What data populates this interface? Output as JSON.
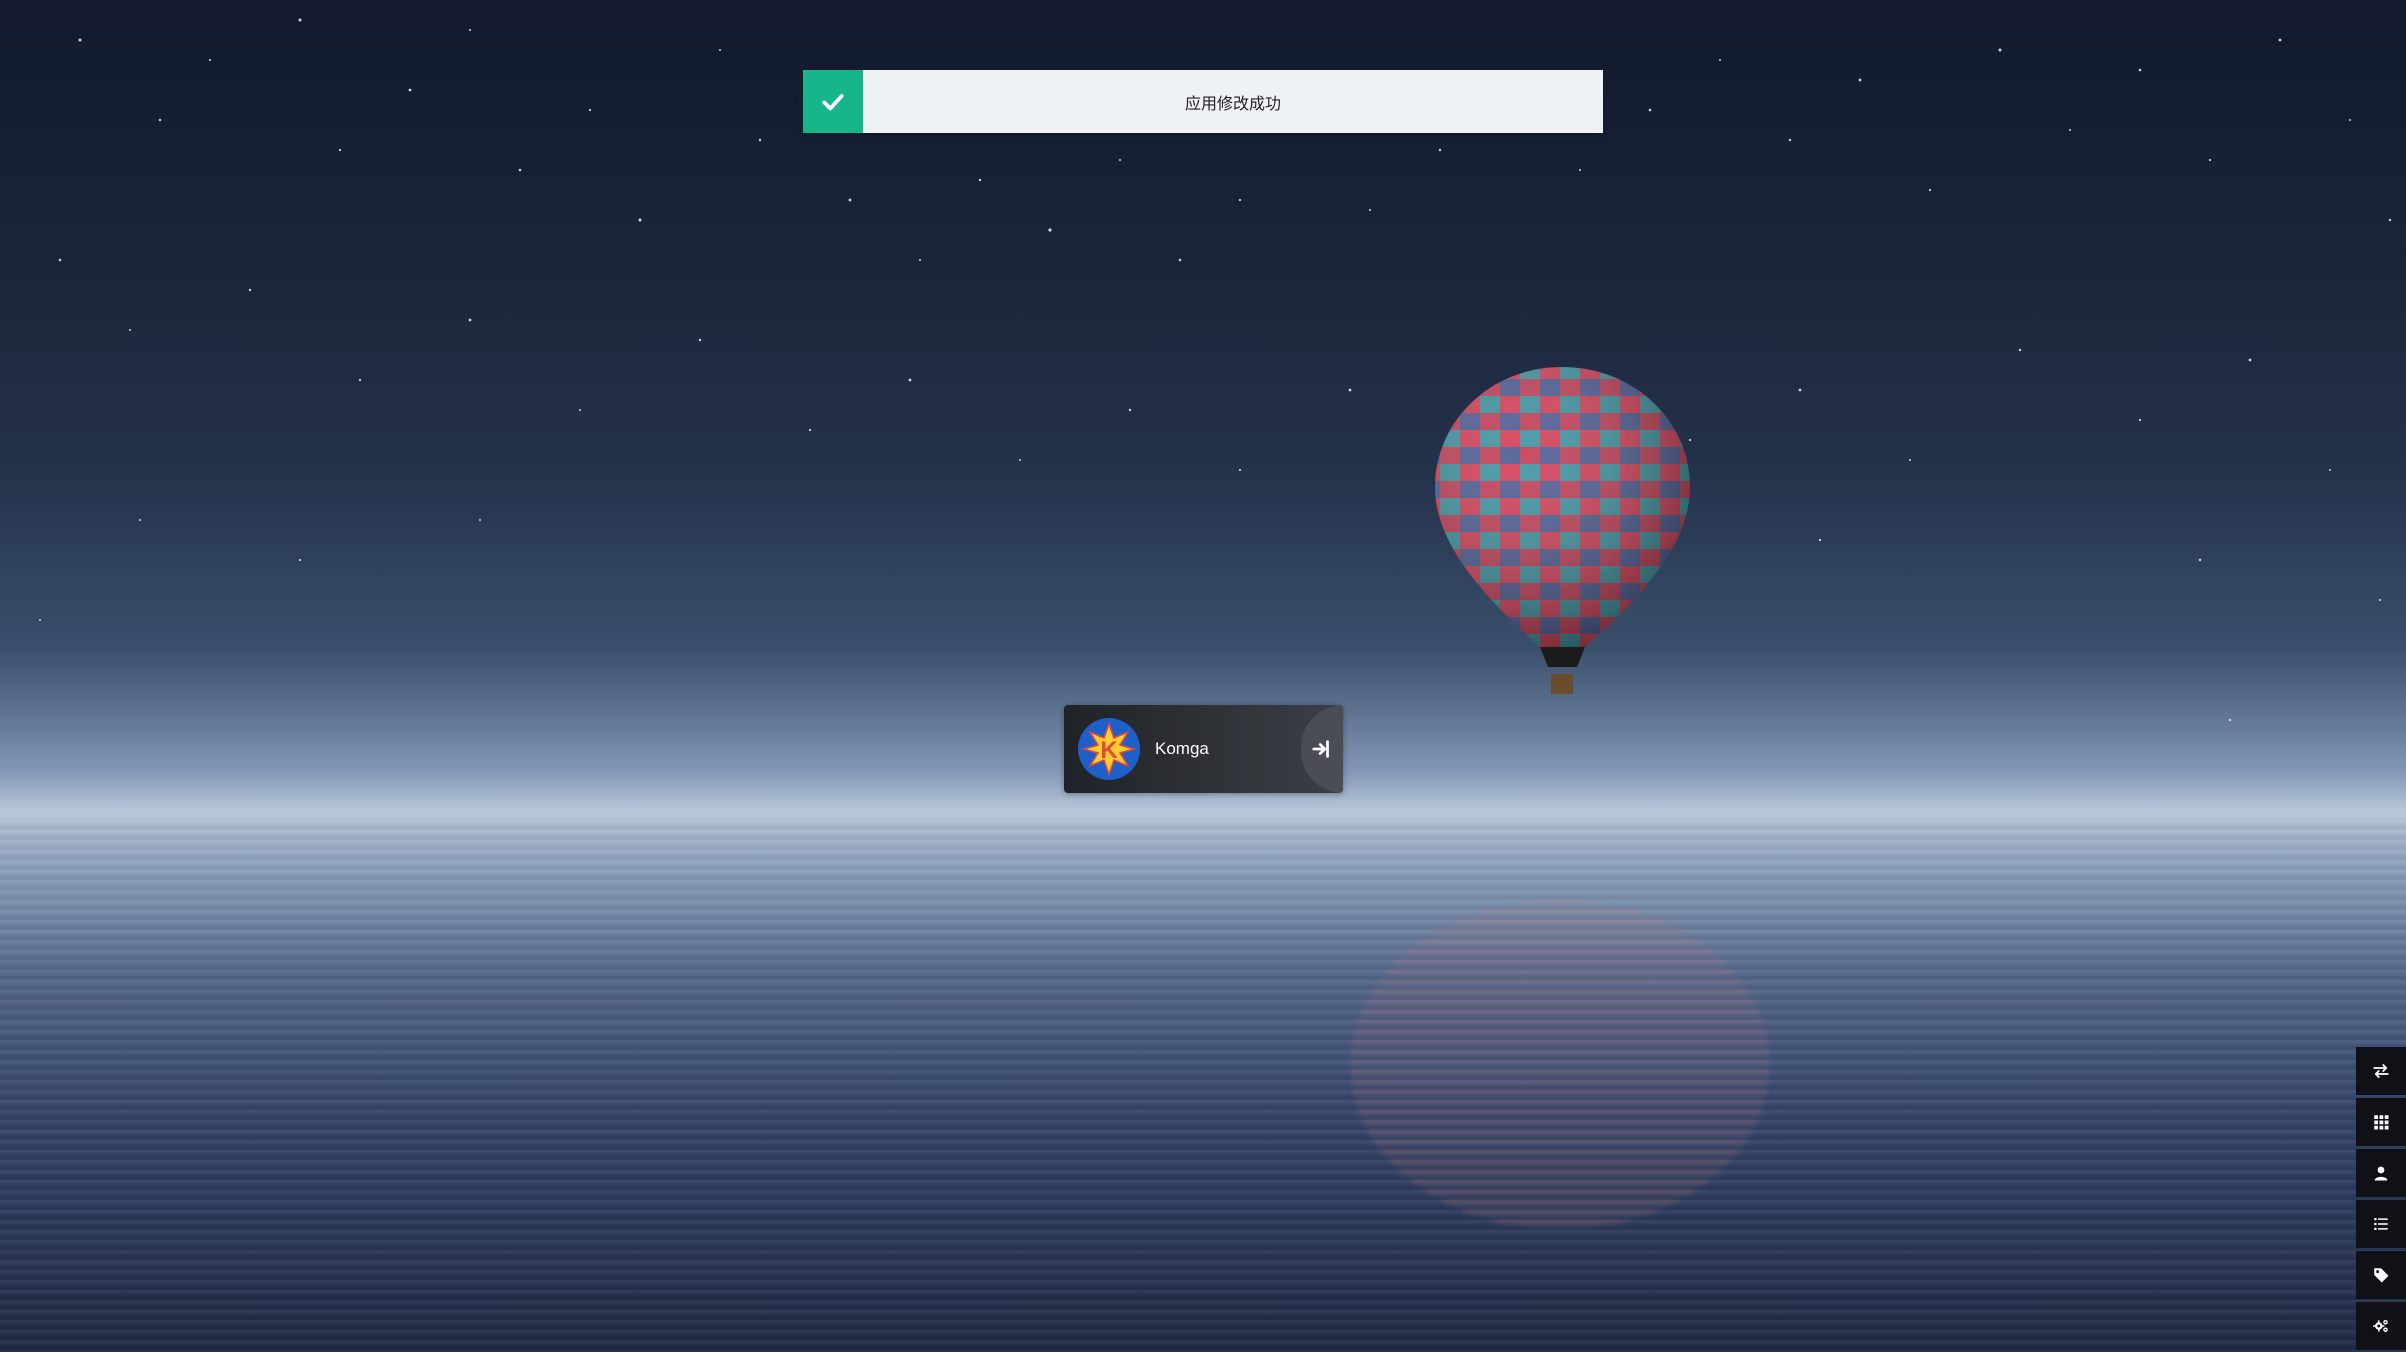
{
  "toast": {
    "message": "应用修改成功",
    "icon": "check-icon",
    "accent_color": "#16b58a"
  },
  "app_card": {
    "title": "Komga",
    "logo_icon": "komga-logo-icon",
    "launch_icon": "sign-in-icon"
  },
  "sidebar": {
    "items": [
      {
        "icon": "exchange-icon"
      },
      {
        "icon": "grid-icon"
      },
      {
        "icon": "user-icon"
      },
      {
        "icon": "list-icon"
      },
      {
        "icon": "tag-icon"
      },
      {
        "icon": "gears-icon"
      }
    ]
  }
}
